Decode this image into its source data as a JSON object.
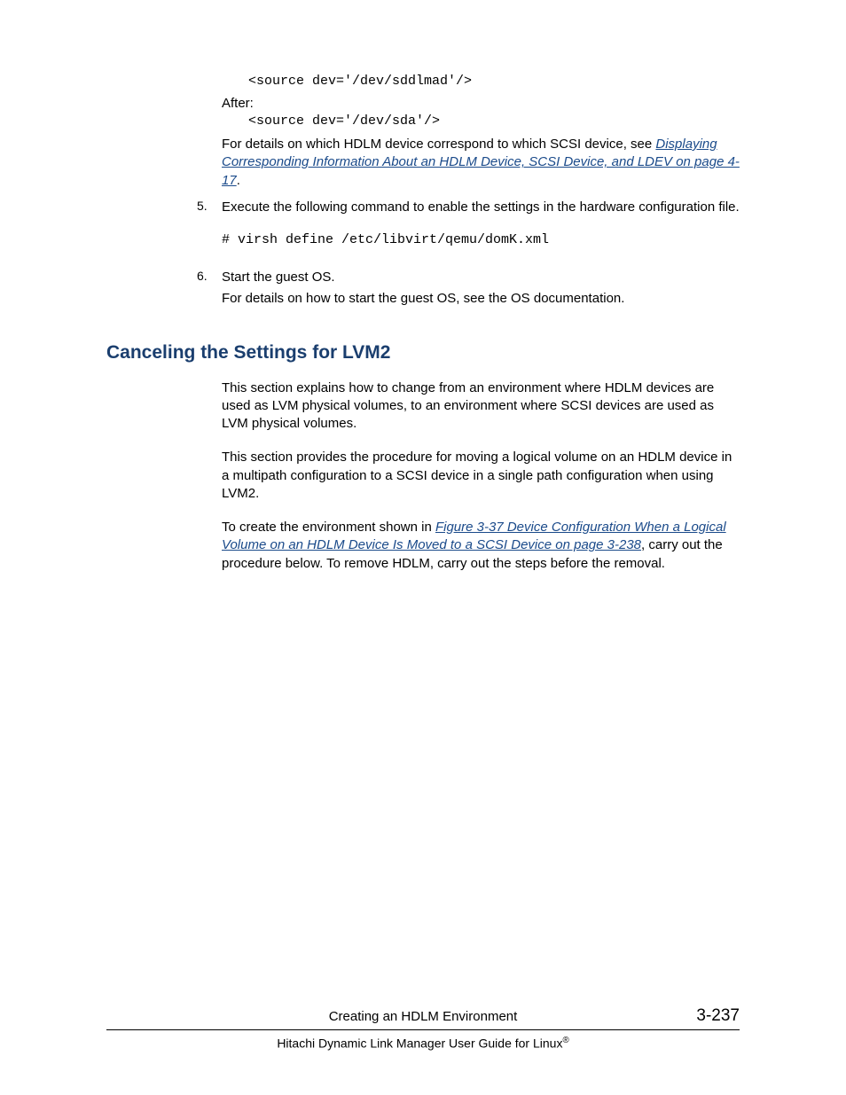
{
  "code_before": "<source dev='/dev/sddlmad'/>",
  "label_after": "After:",
  "code_after": "<source dev='/dev/sda'/>",
  "detail_intro": "For details on which HDLM device correspond to which SCSI device, see ",
  "link1": "Displaying Corresponding Information About an HDLM Device, SCSI Device, and LDEV on page 4-17",
  "period": ".",
  "step5_num": "5.",
  "step5_text": "Execute the following command to enable the settings in the hardware configuration file.",
  "step5_cmd": "# virsh define /etc/libvirt/qemu/domK.xml",
  "step6_num": "6.",
  "step6_text": "Start the guest OS.",
  "step6_detail": "For details on how to start the guest OS, see the OS documentation.",
  "h2": "Canceling the Settings for LVM2",
  "para1": "This section explains how to change from an environment where HDLM devices are used as LVM physical volumes, to an environment where SCSI devices are used as LVM physical volumes.",
  "para2": "This section provides the procedure for moving a logical volume on an HDLM device in a multipath configuration to a SCSI device in a single path configuration when using LVM2.",
  "para3_a": "To create the environment shown in ",
  "link2": "Figure 3-37 Device Configuration When a Logical Volume on an HDLM Device Is Moved to a SCSI Device on page 3-238",
  "para3_b": ", carry out the procedure below. To remove HDLM, carry out the steps before the removal.",
  "footer_chapter": "Creating an HDLM Environment",
  "footer_pagenum": "3-237",
  "footer_doc_a": "Hitachi Dynamic Link Manager User Guide for Linux",
  "footer_doc_b": "®"
}
